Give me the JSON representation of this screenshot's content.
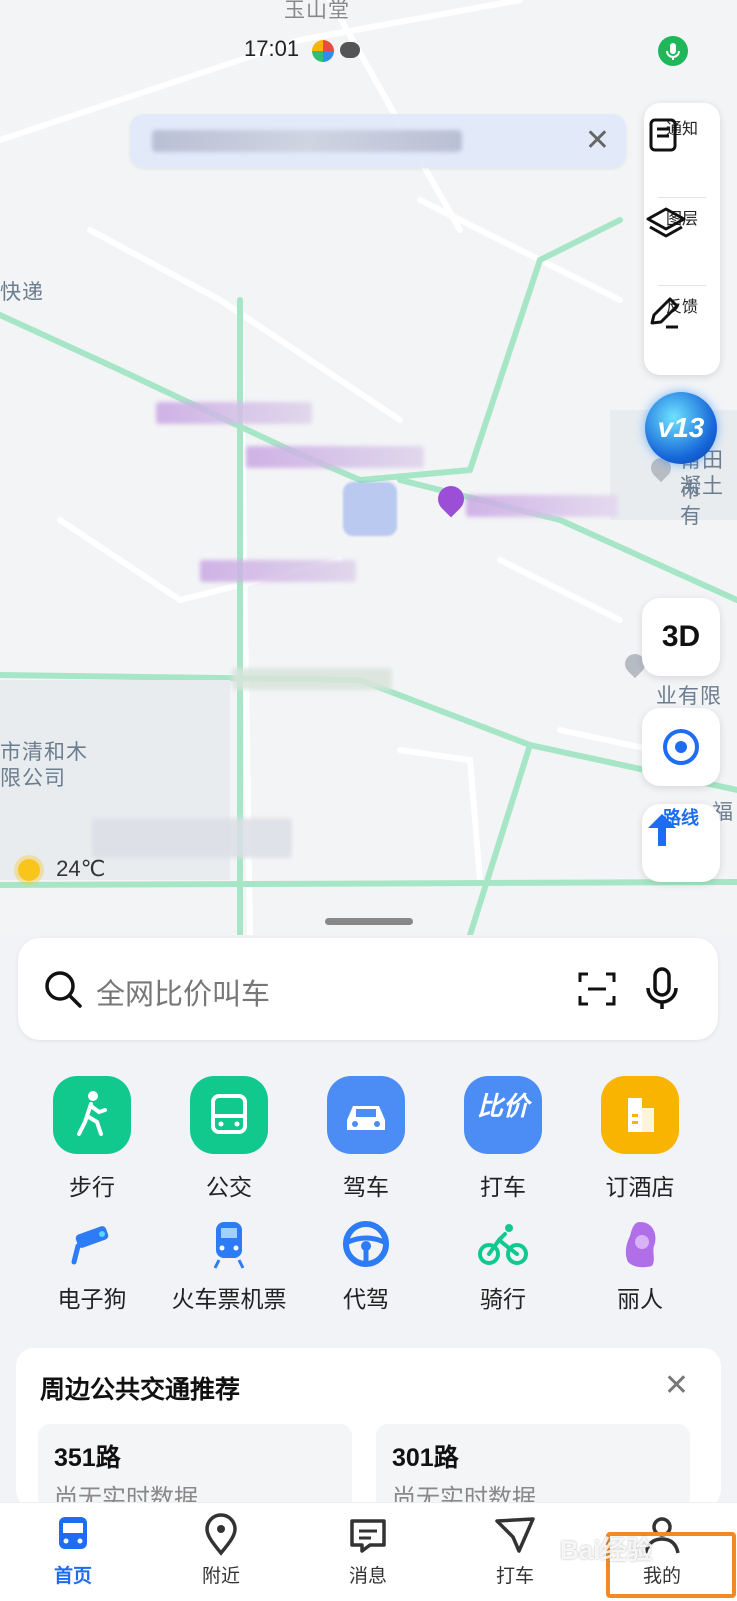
{
  "status": {
    "time": "17:01",
    "top_place": "玉山堂"
  },
  "map": {
    "labels": {
      "express": "快递",
      "company_left_1": "市清和木",
      "company_left_2": "限公司",
      "right_poi_1": "莆田市",
      "right_poi_2": "凝土有",
      "right_poi_3": "业有限公",
      "right_edge": "福"
    },
    "weather_temp": "24℃"
  },
  "tools": {
    "notice": "通知",
    "layers": "图层",
    "feedback": "反馈",
    "badge": "v13",
    "mode_3d": "3D",
    "route": "路线"
  },
  "search": {
    "placeholder": "全网比价叫车"
  },
  "quick_actions": [
    {
      "label": "步行",
      "color": "#12c98d",
      "icon": "walk-icon"
    },
    {
      "label": "公交",
      "color": "#12c98d",
      "icon": "bus-icon"
    },
    {
      "label": "驾车",
      "color": "#4c8cf5",
      "icon": "car-icon"
    },
    {
      "label": "打车",
      "color": "#4c8cf5",
      "icon": "taxi-compare-icon",
      "badge": "比价"
    },
    {
      "label": "订酒店",
      "color": "#f8b400",
      "icon": "hotel-icon"
    }
  ],
  "services": [
    {
      "label": "电子狗",
      "icon": "camera-icon"
    },
    {
      "label": "火车票机票",
      "icon": "train-icon"
    },
    {
      "label": "代驾",
      "icon": "steering-wheel-icon"
    },
    {
      "label": "骑行",
      "icon": "bicycle-icon"
    },
    {
      "label": "丽人",
      "icon": "beauty-icon"
    }
  ],
  "transit": {
    "title": "周边公共交通推荐",
    "routes": [
      {
        "name": "351路",
        "status": "尚无实时数据"
      },
      {
        "name": "301路",
        "status": "尚无实时数据"
      }
    ]
  },
  "tabs": [
    {
      "label": "首页",
      "active": true
    },
    {
      "label": "附近"
    },
    {
      "label": "消息"
    },
    {
      "label": "打车"
    },
    {
      "label": "我的"
    }
  ],
  "watermark": "Bai经验"
}
